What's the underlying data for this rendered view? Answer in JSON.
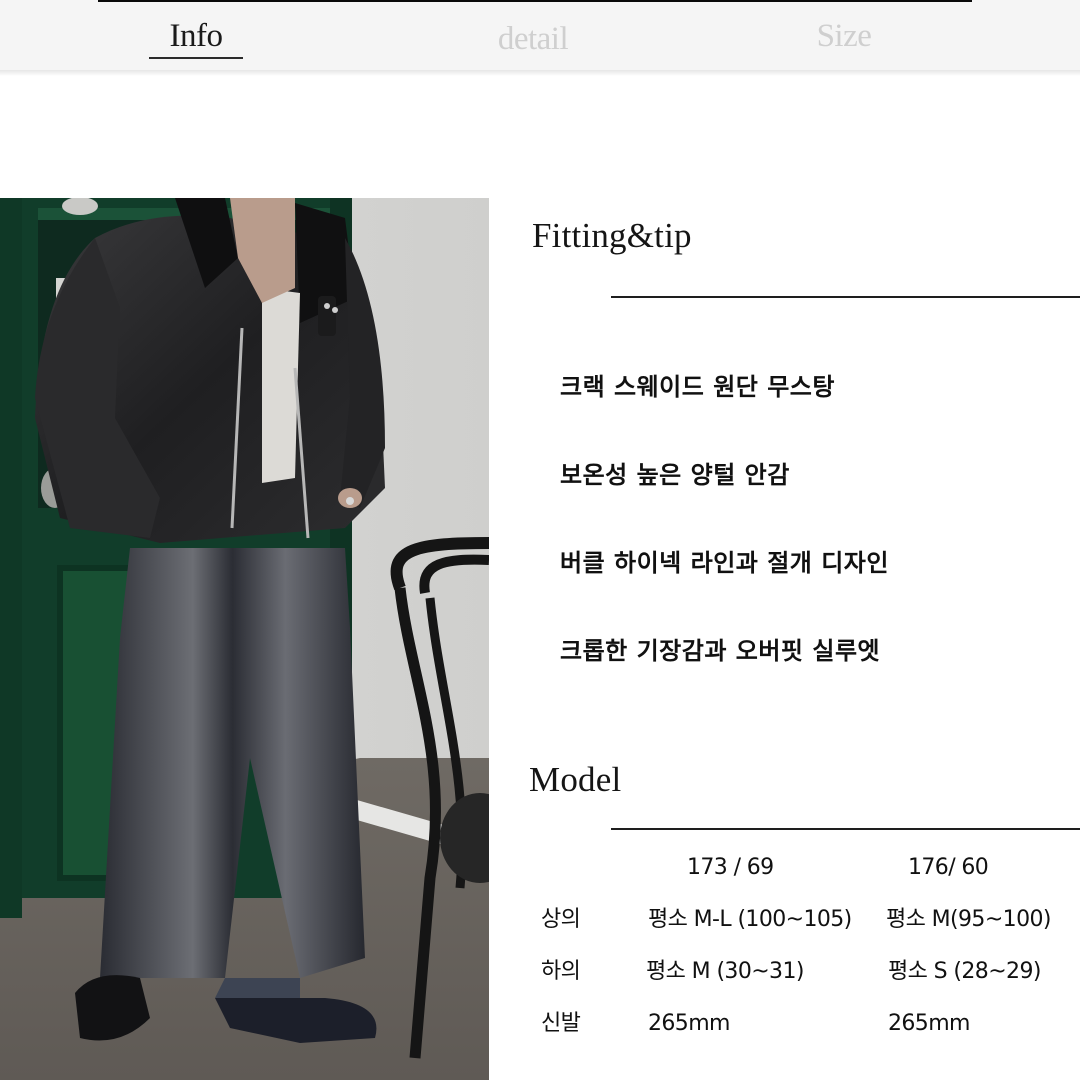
{
  "tabs": [
    {
      "label": "Info",
      "active": true
    },
    {
      "label": "detail",
      "active": false
    },
    {
      "label": "Size",
      "active": false
    }
  ],
  "photo": {
    "description": "Model wearing black cropped leather shearling mustang jacket, white tee, washed black wide denim, black loafers, next to green cabinet and bentwood chair"
  },
  "fitting": {
    "title": "Fitting&tip",
    "tips": [
      "크랙 스웨이드 원단 무스탕",
      "보온성 높은 양털 안감",
      "버클 하이넥 라인과 절개 디자인",
      "크롭한 기장감과 오버핏 실루엣"
    ]
  },
  "model": {
    "title": "Model",
    "columns": [
      "173 / 69",
      "176/ 60"
    ],
    "rows": [
      {
        "label": "상의",
        "values": [
          "평소 M-L (100~105)",
          "평소 M(95~100)"
        ]
      },
      {
        "label": "하의",
        "values": [
          "평소 M (30~31)",
          "평소 S (28~29)"
        ]
      },
      {
        "label": "신발",
        "values": [
          "265mm",
          "265mm"
        ]
      }
    ]
  },
  "colors": {
    "tab_active": "#1a1a1a",
    "tab_inactive": "#cfcfcf",
    "tabbar_bg": "#f5f5f5"
  }
}
